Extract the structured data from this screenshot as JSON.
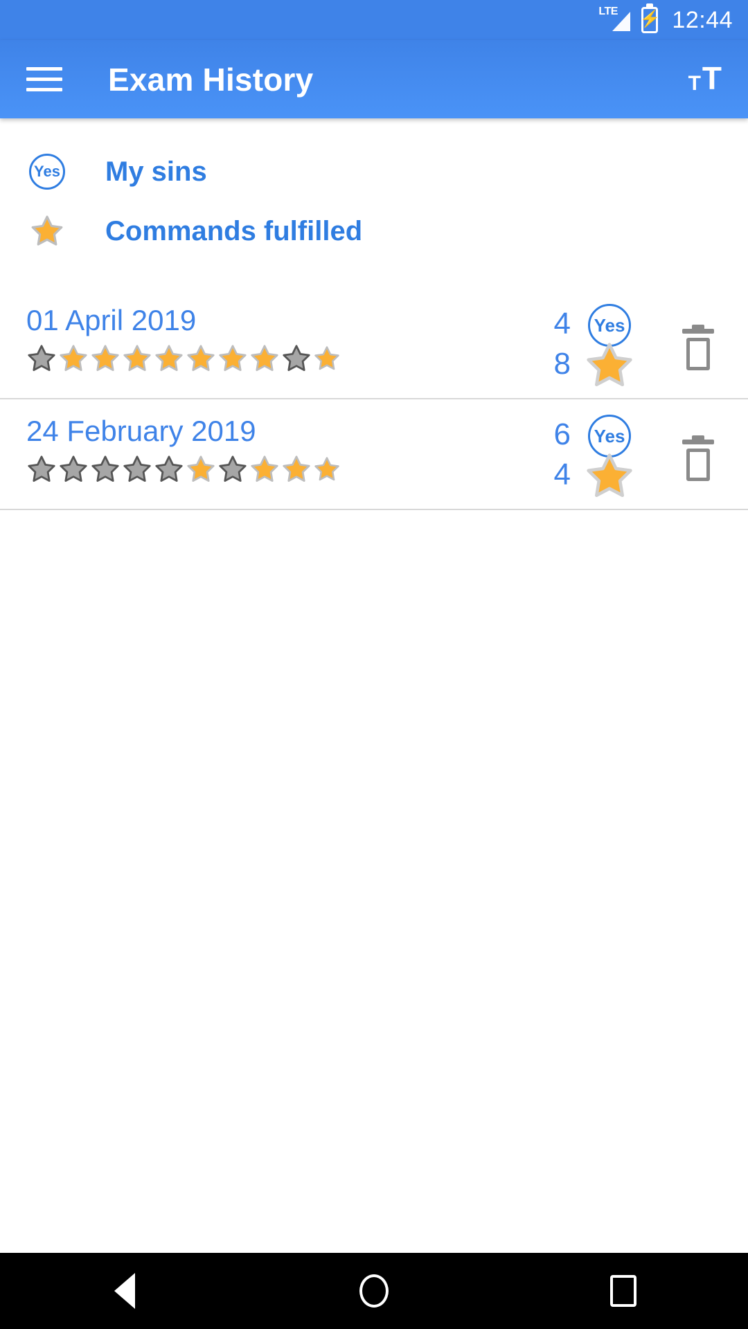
{
  "status_bar": {
    "network_label": "LTE",
    "battery_icon": "battery-charging-icon",
    "signal_icon": "signal-bars-icon",
    "time": "12:44"
  },
  "app_bar": {
    "menu_icon": "hamburger-menu-icon",
    "title": "Exam History",
    "text_size_icon": "format-text-size-icon",
    "text_size_small": "T",
    "text_size_large": "T"
  },
  "legend": [
    {
      "icon": "yes-circle-icon",
      "icon_text": "Yes",
      "label": "My sins"
    },
    {
      "icon": "star-icon",
      "icon_text": "",
      "label": "Commands fulfilled"
    }
  ],
  "history": [
    {
      "date": "01 April 2019",
      "sins_count": "4",
      "commands_count": "8",
      "sins_icon": "yes-circle-icon",
      "sins_icon_text": "Yes",
      "commands_icon": "star-icon",
      "delete_icon": "trash-icon",
      "stars": [
        "gray",
        "gold",
        "gold",
        "gold",
        "gold",
        "gold",
        "gold",
        "gold",
        "gray",
        "gold"
      ]
    },
    {
      "date": "24 February 2019",
      "sins_count": "6",
      "commands_count": "4",
      "sins_icon": "yes-circle-icon",
      "sins_icon_text": "Yes",
      "commands_icon": "star-icon",
      "delete_icon": "trash-icon",
      "stars": [
        "gray",
        "gray",
        "gray",
        "gray",
        "gray",
        "gold",
        "gray",
        "gold",
        "gold",
        "gold"
      ]
    }
  ],
  "nav_bar": {
    "back_icon": "back-triangle-icon",
    "home_icon": "home-circle-icon",
    "recents_icon": "recents-square-icon"
  },
  "colors": {
    "appbar_blue": "#3f83e8",
    "link_blue": "#3f83e8",
    "legend_blue": "#2f7de1",
    "star_gold": "#fbb034",
    "star_gray": "#a6a6a6",
    "divider": "#d8d8d8",
    "trash_gray": "#8a8a8a"
  }
}
